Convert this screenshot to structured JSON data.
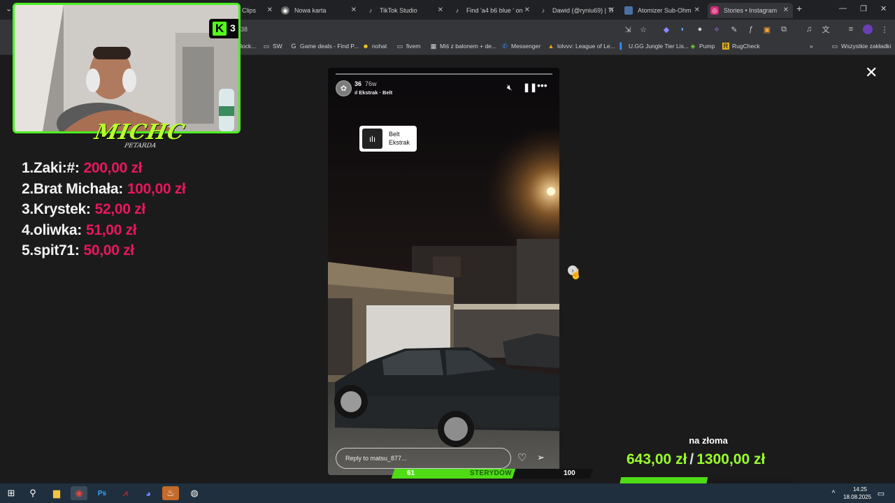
{
  "browser": {
    "tabs": [
      {
        "title": "Clips",
        "icon": "clips-icon"
      },
      {
        "title": "Nowa karta",
        "icon": "chrome-icon"
      },
      {
        "title": "TikTok Studio",
        "icon": "tiktok-icon"
      },
      {
        "title": "Find 'a4 b6 blue ' on",
        "icon": "tiktok-icon"
      },
      {
        "title": "Dawid (@ryniu69) | Ti",
        "icon": "tiktok-icon"
      },
      {
        "title": "Atomizer Sub-Ohm",
        "icon": "image-icon"
      },
      {
        "title": "Stories • Instagram",
        "icon": "instagram-icon",
        "active": true
      }
    ],
    "url_fragment": "38",
    "bookmarks": [
      {
        "label": "lock...",
        "icon": "folder-icon"
      },
      {
        "label": "SW",
        "icon": "folder-icon"
      },
      {
        "label": "Game deals - Find P...",
        "icon": "gg-icon"
      },
      {
        "label": "nohat",
        "icon": "smiley-icon"
      },
      {
        "label": "fivem",
        "icon": "folder-icon"
      },
      {
        "label": "Miś z balonem + de...",
        "icon": "image-icon"
      },
      {
        "label": "Messenger",
        "icon": "messenger-icon"
      },
      {
        "label": "lolvvv: League of Le...",
        "icon": "lolvvv-icon"
      },
      {
        "label": "U.GG Jungle Tier Lis...",
        "icon": "ugg-icon"
      },
      {
        "label": "Pump",
        "icon": "pill-icon"
      },
      {
        "label": "RugCheck",
        "icon": "rugcheck-icon"
      }
    ],
    "all_bookmarks": "Wszystkie zakładki"
  },
  "story": {
    "username": "36",
    "time": "76w",
    "music": "Ekstrak · Belt",
    "sticker": {
      "song": "Belt",
      "artist": "Ekstrak"
    },
    "reply_placeholder": "Reply to matsu_877..."
  },
  "overlay": {
    "kick_viewers": "3",
    "streamer_logo": "MICHC",
    "streamer_logo_sub": "PETARDA",
    "leaderboard": [
      {
        "rank": "1.",
        "name": "Zaki:#:",
        "amount": "200,00 zł"
      },
      {
        "rank": "2.",
        "name": "Brat Michała:",
        "amount": "100,00 zł"
      },
      {
        "rank": "3.",
        "name": "Krystek:",
        "amount": "52,00 zł"
      },
      {
        "rank": "4.",
        "name": "oliwka:",
        "amount": "51,00 zł"
      },
      {
        "rank": "5.",
        "name": "spit71:",
        "amount": "50,00 zł"
      }
    ],
    "goal": {
      "title": "na złoma",
      "current": "643,00 zł",
      "separator": "/",
      "target": "1300,00 zł",
      "progress": 0.495
    },
    "subs": {
      "current": "61",
      "label": "STERYDÓW",
      "target": "100",
      "progress": 0.61
    }
  },
  "taskbar": {
    "time": "14:25",
    "date": "18.08.2025"
  },
  "colors": {
    "accent_green": "#4af01e",
    "donation_pink": "#e8175d",
    "goal_green": "#9bff2a"
  }
}
